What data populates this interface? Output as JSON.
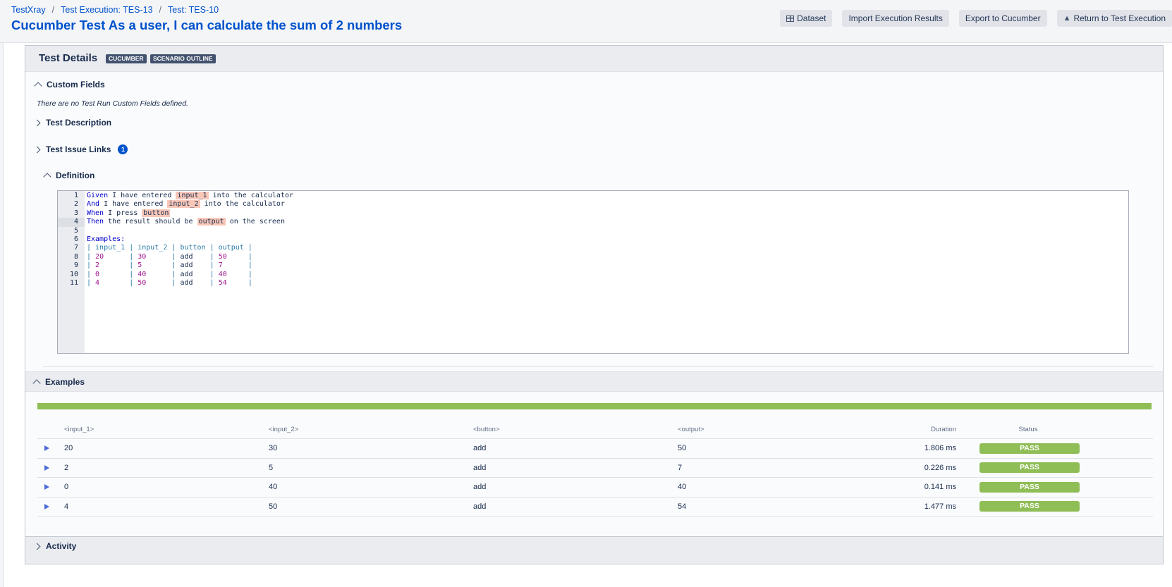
{
  "breadcrumb": [
    "TestXray",
    "Test Execution: TES-13",
    "Test: TES-10"
  ],
  "title": "Cucumber Test As a user, I can calculate the sum of 2 numbers",
  "toolbar": {
    "dataset": "Dataset",
    "import": "Import Execution Results",
    "export": "Export to Cucumber",
    "return": "Return to Test Execution"
  },
  "details": {
    "title": "Test Details",
    "lozenges": [
      "CUCUMBER",
      "SCENARIO OUTLINE"
    ]
  },
  "sections": {
    "custom_fields": "Custom Fields",
    "no_fields_note": "There are no Test Run Custom Fields defined.",
    "description": "Test Description",
    "issue_links": "Test Issue Links",
    "issue_links_count": "1",
    "definition": "Definition",
    "examples": "Examples",
    "activity": "Activity"
  },
  "code": {
    "active_line": 4,
    "lines": [
      {
        "n": "1",
        "parts": [
          {
            "t": "Given",
            "c": "kw"
          },
          {
            "t": " I have entered "
          },
          {
            "t": "input_1",
            "c": "hl"
          },
          {
            "t": " into the calculator"
          }
        ]
      },
      {
        "n": "2",
        "parts": [
          {
            "t": "And",
            "c": "kw"
          },
          {
            "t": " I have entered "
          },
          {
            "t": "input_2",
            "c": "hl"
          },
          {
            "t": " into the calculator"
          }
        ]
      },
      {
        "n": "3",
        "parts": [
          {
            "t": "When",
            "c": "kw"
          },
          {
            "t": " I press "
          },
          {
            "t": "button",
            "c": "hl"
          }
        ]
      },
      {
        "n": "4",
        "parts": [
          {
            "t": "Then",
            "c": "kw"
          },
          {
            "t": " the result should be "
          },
          {
            "t": "output",
            "c": "hl"
          },
          {
            "t": " on the screen"
          }
        ]
      },
      {
        "n": "5",
        "parts": []
      },
      {
        "n": "6",
        "parts": [
          {
            "t": "Examples:",
            "c": "kw"
          }
        ]
      },
      {
        "n": "7",
        "parts": [
          {
            "t": "| input_1 | input_2 | button | output |",
            "c": "tbl"
          }
        ]
      },
      {
        "n": "8",
        "parts": [
          {
            "t": "| ",
            "c": "tbl"
          },
          {
            "t": "20      ",
            "c": "num"
          },
          {
            "t": "| ",
            "c": "tbl"
          },
          {
            "t": "30      ",
            "c": "num"
          },
          {
            "t": "| ",
            "c": "tbl"
          },
          {
            "t": "add    "
          },
          {
            "t": "| ",
            "c": "tbl"
          },
          {
            "t": "50     ",
            "c": "num"
          },
          {
            "t": "|",
            "c": "tbl"
          }
        ]
      },
      {
        "n": "9",
        "parts": [
          {
            "t": "| ",
            "c": "tbl"
          },
          {
            "t": "2       ",
            "c": "num"
          },
          {
            "t": "| ",
            "c": "tbl"
          },
          {
            "t": "5       ",
            "c": "num"
          },
          {
            "t": "| ",
            "c": "tbl"
          },
          {
            "t": "add    "
          },
          {
            "t": "| ",
            "c": "tbl"
          },
          {
            "t": "7      ",
            "c": "num"
          },
          {
            "t": "|",
            "c": "tbl"
          }
        ]
      },
      {
        "n": "10",
        "parts": [
          {
            "t": "| ",
            "c": "tbl"
          },
          {
            "t": "0       ",
            "c": "num"
          },
          {
            "t": "| ",
            "c": "tbl"
          },
          {
            "t": "40      ",
            "c": "num"
          },
          {
            "t": "| ",
            "c": "tbl"
          },
          {
            "t": "add    "
          },
          {
            "t": "| ",
            "c": "tbl"
          },
          {
            "t": "40     ",
            "c": "num"
          },
          {
            "t": "|",
            "c": "tbl"
          }
        ]
      },
      {
        "n": "11",
        "parts": [
          {
            "t": "| ",
            "c": "tbl"
          },
          {
            "t": "4       ",
            "c": "num"
          },
          {
            "t": "| ",
            "c": "tbl"
          },
          {
            "t": "50      ",
            "c": "num"
          },
          {
            "t": "| ",
            "c": "tbl"
          },
          {
            "t": "add    "
          },
          {
            "t": "| ",
            "c": "tbl"
          },
          {
            "t": "54     ",
            "c": "num"
          },
          {
            "t": "|",
            "c": "tbl"
          }
        ]
      }
    ]
  },
  "examples": {
    "progress_pass_fraction": 1.0,
    "pass_color": "#8fbd56",
    "columns": [
      "<input_1>",
      "<input_2>",
      "<button>",
      "<output>",
      "Duration",
      "Status"
    ],
    "rows": [
      {
        "input_1": "20",
        "input_2": "30",
        "button": "add",
        "output": "50",
        "duration": "1.806 ms",
        "status": "PASS"
      },
      {
        "input_1": "2",
        "input_2": "5",
        "button": "add",
        "output": "7",
        "duration": "0.226 ms",
        "status": "PASS"
      },
      {
        "input_1": "0",
        "input_2": "40",
        "button": "add",
        "output": "40",
        "duration": "0.141 ms",
        "status": "PASS"
      },
      {
        "input_1": "4",
        "input_2": "50",
        "button": "add",
        "output": "54",
        "duration": "1.477 ms",
        "status": "PASS"
      }
    ]
  }
}
